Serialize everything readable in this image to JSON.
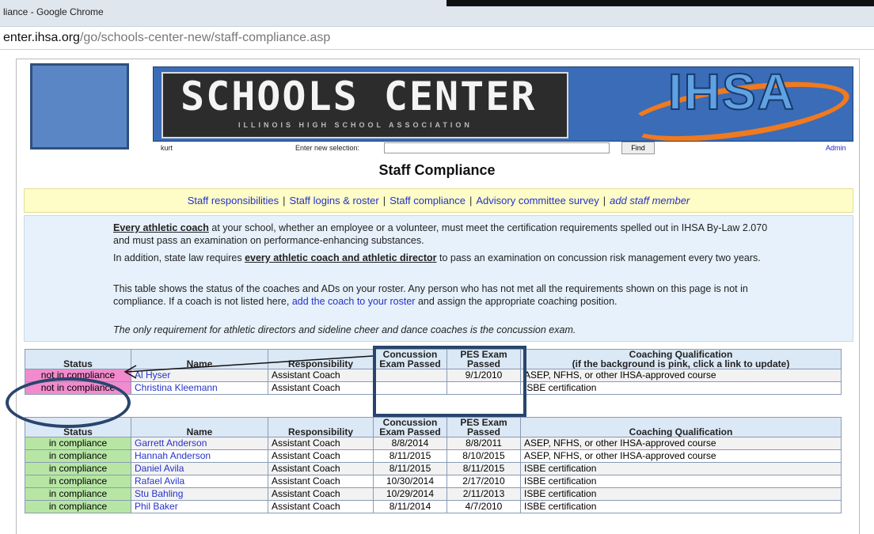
{
  "browser": {
    "title": "liance - Google Chrome",
    "url_host": "enter.ihsa.org",
    "url_path": "/go/schools-center-new/staff-compliance.asp"
  },
  "header": {
    "banner_title": "SCHOOLS CENTER",
    "banner_subtitle": "ILLINOIS HIGH SCHOOL ASSOCIATION",
    "logo_text": "IHSA",
    "user": "kurt",
    "selection_label": "Enter new selection:",
    "selection_value": "",
    "find_label": "Find",
    "admin_label": "Admin"
  },
  "page": {
    "title": "Staff Compliance"
  },
  "nav": {
    "items": [
      "Staff responsibilities",
      "Staff logins & roster",
      "Staff compliance",
      "Advisory committee survey"
    ],
    "add": "add staff member"
  },
  "info": {
    "p1_bold": "Every athletic coach",
    "p1_rest": " at your school, whether an employee or a volunteer, must meet the certification requirements spelled out in IHSA By-Law 2.070 and must pass an examination on performance-enhancing substances.",
    "p2_pre": "In addition, state law requires ",
    "p2_bold": "every athletic coach and athletic director",
    "p2_rest": " to pass an examination on concussion risk management every two years.",
    "p3_pre": "This table shows the status of the coaches and ADs on your roster. Any person who has not met all the requirements shown on this page is not in compliance. If a coach is not listed here, ",
    "p3_link": "add the coach to your roster",
    "p3_rest": " and assign the appropriate coaching position.",
    "p4": "The only requirement for athletic directors and sideline cheer and dance coaches is the concussion exam."
  },
  "table_headers": {
    "status": "Status",
    "name": "Name",
    "responsibility": "Responsibility",
    "concussion": "Concussion Exam Passed",
    "pes": "PES Exam Passed",
    "qual1": "Coaching Qualification",
    "qual2": "(if the background is pink, click a link to update)"
  },
  "noncompliant": [
    {
      "status": "not in compliance",
      "name": "Al Hyser",
      "resp": "Assistant Coach",
      "conc": "",
      "pes": "9/1/2010",
      "qual": "ASEP, NFHS, or other IHSA-approved course"
    },
    {
      "status": "not in compliance",
      "name": "Christina Kleemann",
      "resp": "Assistant Coach",
      "conc": "",
      "pes": "",
      "qual": "ISBE certification"
    }
  ],
  "compliant": [
    {
      "status": "in compliance",
      "name": "Garrett Anderson",
      "resp": "Assistant Coach",
      "conc": "8/8/2014",
      "pes": "8/8/2011",
      "qual": "ASEP, NFHS, or other IHSA-approved course"
    },
    {
      "status": "in compliance",
      "name": "Hannah Anderson",
      "resp": "Assistant Coach",
      "conc": "8/11/2015",
      "pes": "8/10/2015",
      "qual": "ASEP, NFHS, or other IHSA-approved course"
    },
    {
      "status": "in compliance",
      "name": "Daniel Avila",
      "resp": "Assistant Coach",
      "conc": "8/11/2015",
      "pes": "8/11/2015",
      "qual": "ISBE certification"
    },
    {
      "status": "in compliance",
      "name": "Rafael Avila",
      "resp": "Assistant Coach",
      "conc": "10/30/2014",
      "pes": "2/17/2010",
      "qual": "ISBE certification"
    },
    {
      "status": "in compliance",
      "name": "Stu Bahling",
      "resp": "Assistant Coach",
      "conc": "10/29/2014",
      "pes": "2/11/2013",
      "qual": "ISBE certification"
    },
    {
      "status": "in compliance",
      "name": "Phil Baker",
      "resp": "Assistant Coach",
      "conc": "8/11/2014",
      "pes": "4/7/2010",
      "qual": "ISBE certification"
    }
  ]
}
